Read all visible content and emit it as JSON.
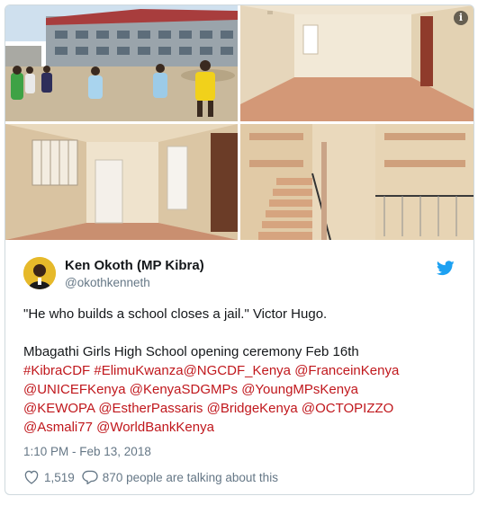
{
  "tweet": {
    "author_name": "Ken Okoth (MP Kibra)",
    "author_handle": "@okothkenneth",
    "quote": "\"He who builds a school closes a jail.\" Victor Hugo.",
    "event_text": "Mbagathi Girls High School opening ceremony Feb 16th",
    "tags_line1": [
      "#KibraCDF",
      "#ElimuKwanza@NGCDF_Kenya",
      "@FranceinKenya"
    ],
    "tags_line2": [
      "@UNICEFKenya",
      "@KenyaSDGMPs",
      "@YoungMPsKenya"
    ],
    "tags_line3": [
      "@KEWOPA",
      "@EstherPassaris",
      "@BridgeKenya",
      "@OCTOPIZZO"
    ],
    "tags_line4": [
      "@Asmali77",
      "@WorldBankKenya"
    ],
    "timestamp": "1:10 PM - Feb 13, 2018",
    "likes": "1,519",
    "talking": "870 people are talking about this"
  },
  "icons": {
    "info": "info-icon",
    "bird": "twitter-bird-icon",
    "heart": "heart-icon",
    "reply": "reply-bubble-icon"
  },
  "colors": {
    "link": "#c0171c",
    "name": "#14171a",
    "secondary": "#657786",
    "twitter_blue": "#1da1f2",
    "border": "#cfd9de"
  }
}
